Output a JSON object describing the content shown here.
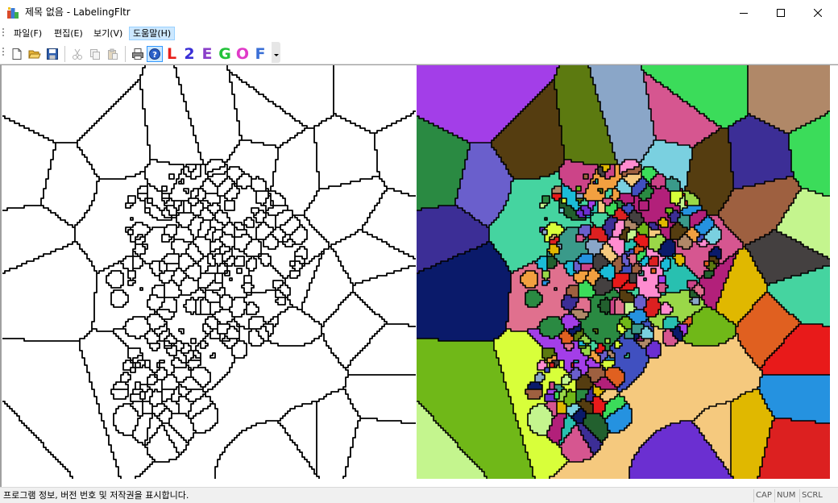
{
  "window": {
    "title": "제목 없음 - LabelingFltr",
    "controls": [
      "minimize",
      "maximize",
      "close"
    ]
  },
  "menu": {
    "items": [
      {
        "label": "파일(F)"
      },
      {
        "label": "편집(E)"
      },
      {
        "label": "보기(V)"
      },
      {
        "label": "도움말(H)",
        "active": true
      }
    ]
  },
  "toolbar": {
    "buttons": [
      {
        "icon": "new-document-icon"
      },
      {
        "icon": "open-folder-icon"
      },
      {
        "icon": "save-icon"
      },
      {
        "icon": "cut-icon",
        "enabled": false
      },
      {
        "icon": "copy-icon",
        "enabled": false
      },
      {
        "icon": "paste-icon",
        "enabled": false
      },
      {
        "icon": "print-icon"
      },
      {
        "icon": "help-icon",
        "pressed": true
      },
      {
        "glyph": "L",
        "color": "#e8201a"
      },
      {
        "glyph": "2",
        "color": "#3a2fd6"
      },
      {
        "glyph": "E",
        "color": "#8a3fc9"
      },
      {
        "glyph": "G",
        "color": "#22c23a"
      },
      {
        "glyph": "O",
        "color": "#e03ac8"
      },
      {
        "glyph": "F",
        "color": "#3a6fd6"
      }
    ]
  },
  "images": {
    "left": {
      "kind": "binary-edge-image",
      "background": "#ffffff",
      "edge_color": "#000000"
    },
    "right": {
      "kind": "labeled-region-image"
    }
  },
  "statusbar": {
    "message": "프로그램 정보, 버전 번호 및 저작권을 표시합니다.",
    "indicators": [
      "CAP",
      "NUM",
      "SCRL"
    ]
  }
}
